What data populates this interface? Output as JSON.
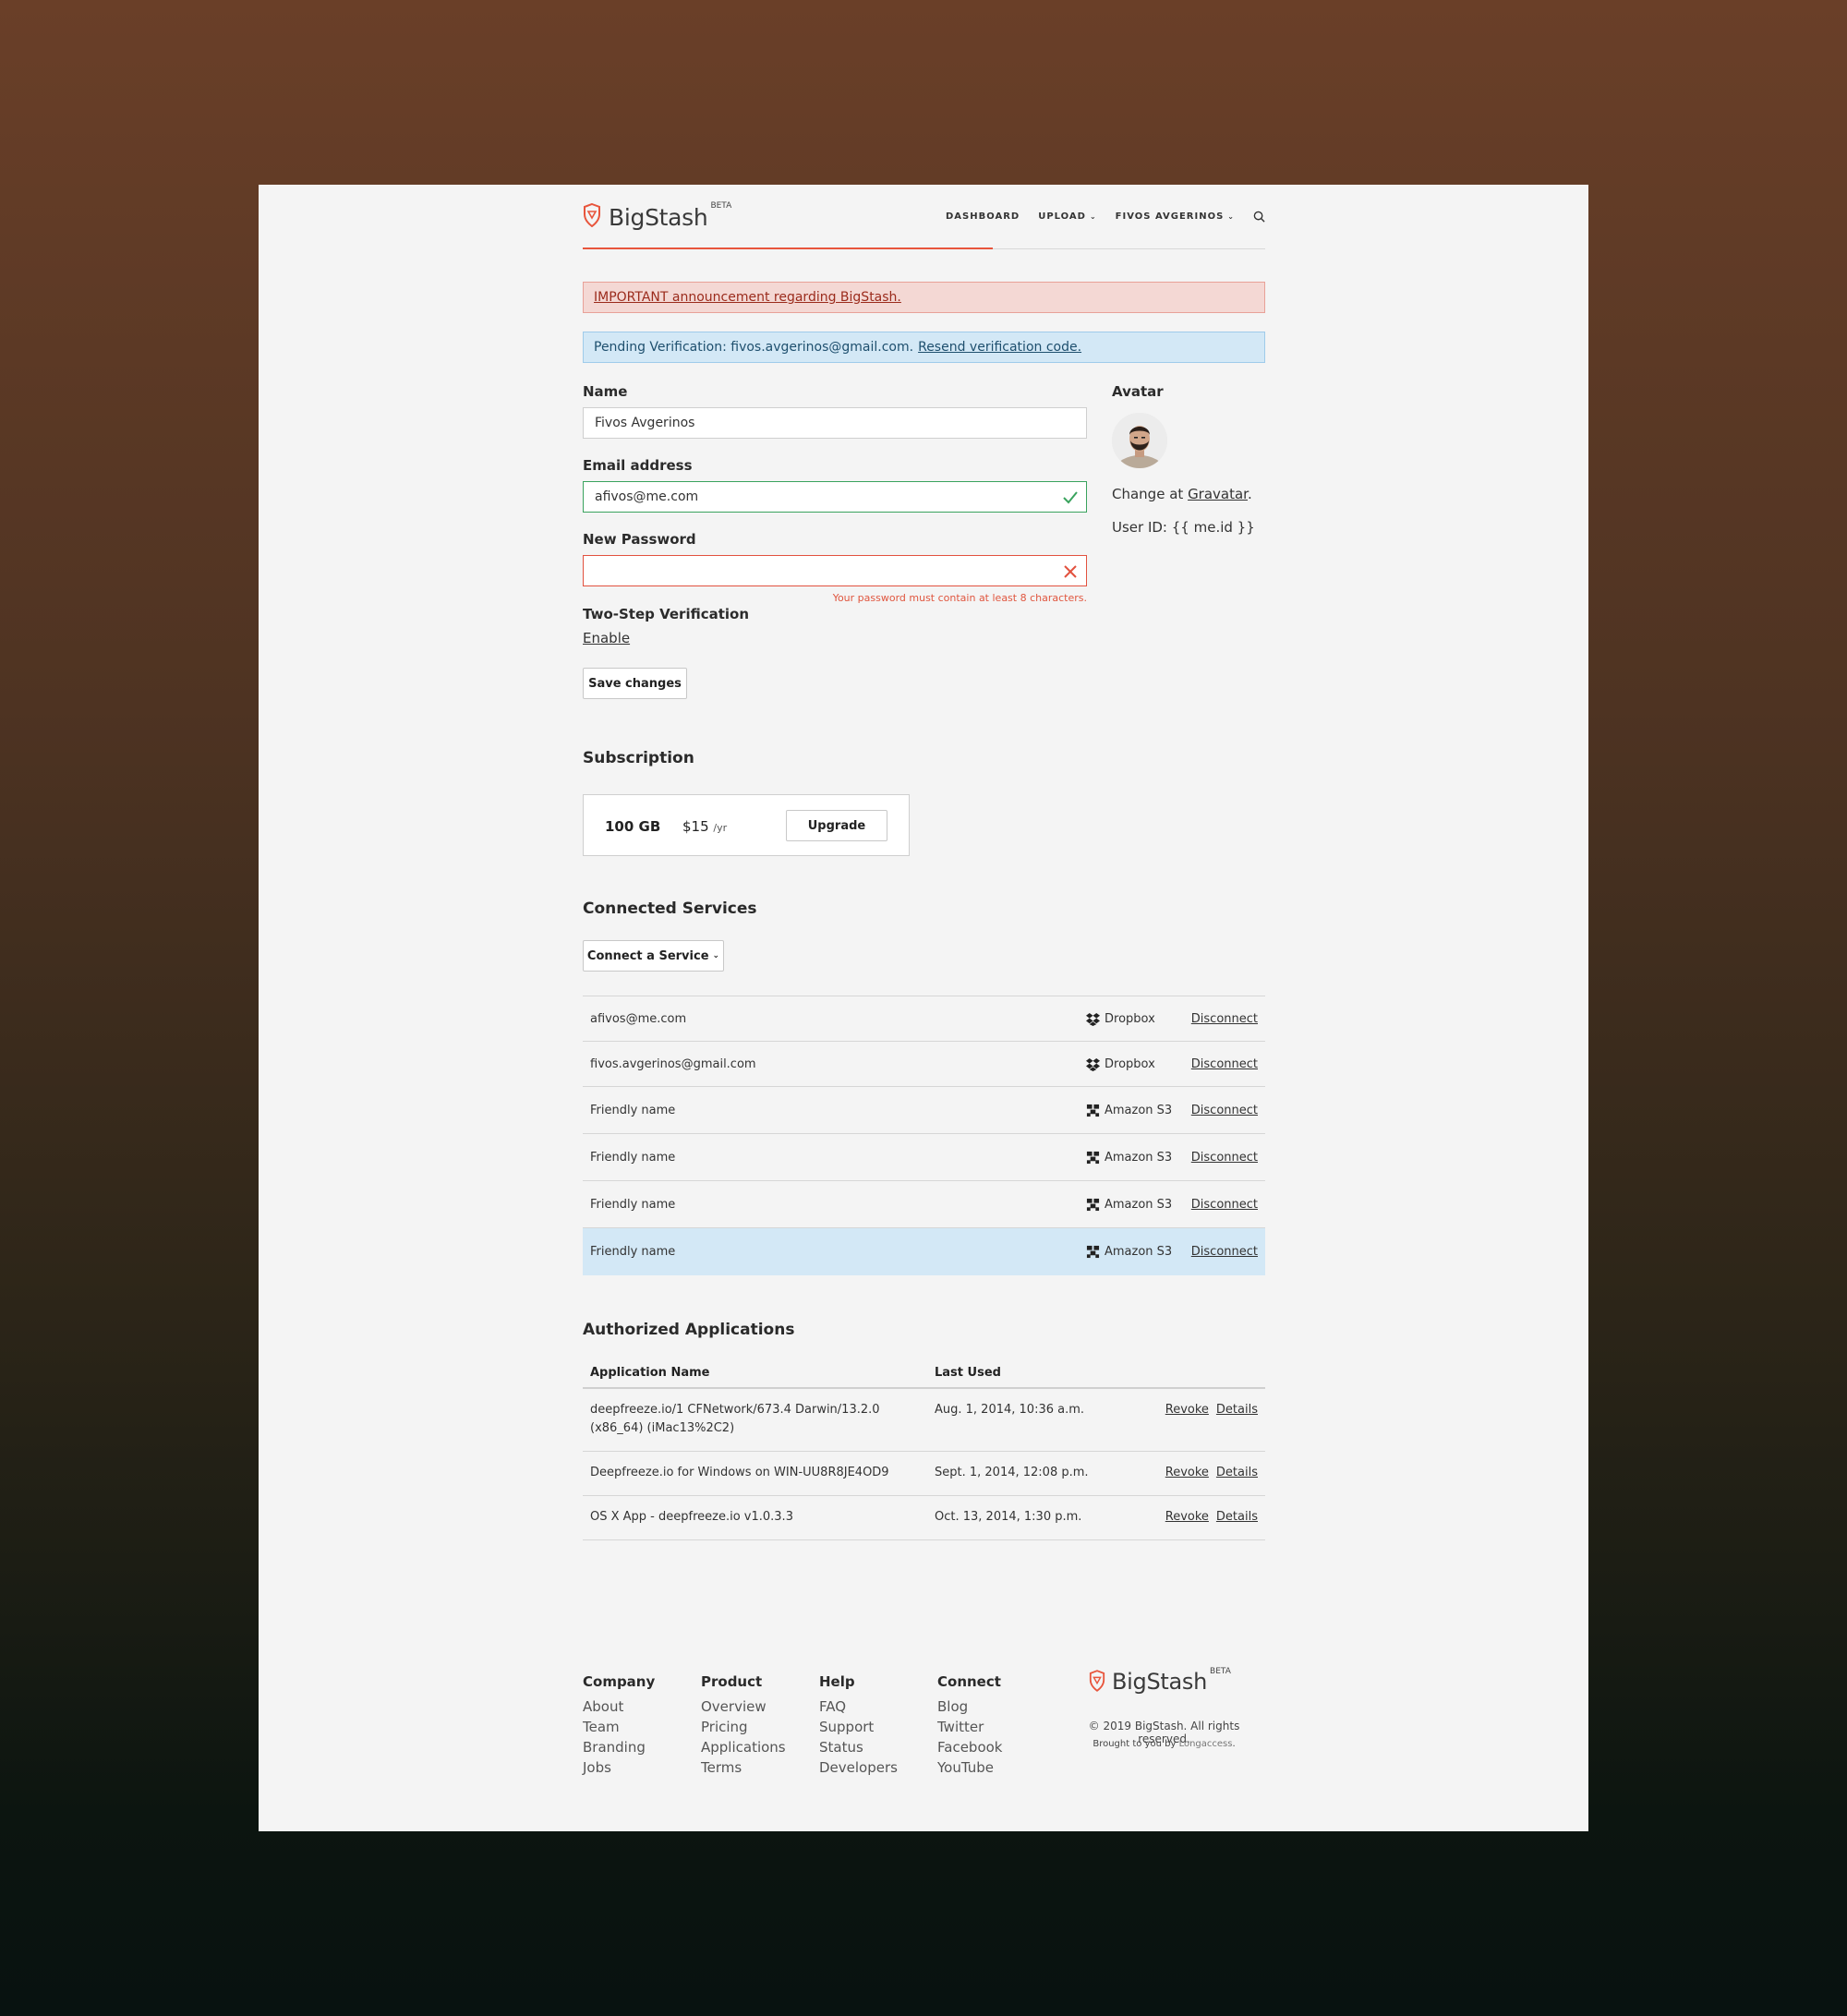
{
  "header": {
    "brand": "BigStash",
    "beta": "BETA",
    "nav": {
      "dashboard": "DASHBOARD",
      "upload": "UPLOAD",
      "user": "FIVOS AVGERINOS"
    }
  },
  "alerts": {
    "announcement": "IMPORTANT announcement regarding BigStash.",
    "pending_prefix": "Pending Verification: fivos.avgerinos@gmail.com.",
    "pending_link": "Resend verification code."
  },
  "form": {
    "name_label": "Name",
    "name_value": "Fivos Avgerinos",
    "email_label": "Email address",
    "email_value": "afivos@me.com",
    "password_label": "New Password",
    "password_value": "",
    "password_error": "Your password must contain at least 8 characters.",
    "twostep_label": "Two-Step Verification",
    "twostep_link": "Enable",
    "save_label": "Save changes"
  },
  "avatar": {
    "label": "Avatar",
    "change_prefix": "Change at",
    "change_link": "Gravatar",
    "change_suffix": ".",
    "user_id": "User ID: {{ me.id }}"
  },
  "subscription": {
    "title": "Subscription",
    "size": "100 GB",
    "price": "$15",
    "period": "/yr",
    "upgrade_label": "Upgrade"
  },
  "services": {
    "title": "Connected Services",
    "connect_label": "Connect a Service",
    "rows": [
      {
        "account": "afivos@me.com",
        "provider": "Dropbox",
        "action": "Disconnect"
      },
      {
        "account": "fivos.avgerinos@gmail.com",
        "provider": "Dropbox",
        "action": "Disconnect"
      },
      {
        "account": "Friendly name",
        "provider": "Amazon S3",
        "action": "Disconnect"
      },
      {
        "account": "Friendly name",
        "provider": "Amazon S3",
        "action": "Disconnect"
      },
      {
        "account": "Friendly name",
        "provider": "Amazon S3",
        "action": "Disconnect"
      },
      {
        "account": "Friendly name",
        "provider": "Amazon S3",
        "action": "Disconnect"
      }
    ]
  },
  "applications": {
    "title": "Authorized Applications",
    "col_name": "Application Name",
    "col_last": "Last Used",
    "rows": [
      {
        "name": "deepfreeze.io/1 CFNetwork/673.4 Darwin/13.2.0 (x86_64) (iMac13%2C2)",
        "last": "Aug. 1, 2014, 10:36 a.m.",
        "revoke": "Revoke",
        "details": "Details"
      },
      {
        "name": "Deepfreeze.io for Windows on WIN-UU8R8JE4OD9",
        "last": "Sept. 1, 2014, 12:08 p.m.",
        "revoke": "Revoke",
        "details": "Details"
      },
      {
        "name": "OS X App - deepfreeze.io v1.0.3.3",
        "last": "Oct. 13, 2014, 1:30 p.m.",
        "revoke": "Revoke",
        "details": "Details"
      }
    ]
  },
  "footer": {
    "company": {
      "title": "Company",
      "links": [
        "About",
        "Team",
        "Branding",
        "Jobs"
      ]
    },
    "product": {
      "title": "Product",
      "links": [
        "Overview",
        "Pricing",
        "Applications",
        "Terms"
      ]
    },
    "help": {
      "title": "Help",
      "links": [
        "FAQ",
        "Support",
        "Status",
        "Developers"
      ]
    },
    "connect": {
      "title": "Connect",
      "links": [
        "Blog",
        "Twitter",
        "Facebook",
        "YouTube"
      ]
    },
    "brand": "BigStash",
    "beta": "BETA",
    "copyright": "© 2019 BigStash. All rights reserved.",
    "brought_prefix": "Brought to you by",
    "brought_link": "Longaccess",
    "brought_suffix": "."
  },
  "colors": {
    "accent": "#e8553c",
    "success": "#3aa35e",
    "info_bg": "#d3e8f6",
    "danger_bg": "#f4d8d4"
  },
  "icons": [
    "shield-logo-icon",
    "search-icon",
    "chevron-down-icon",
    "check-icon",
    "x-icon",
    "dropbox-icon",
    "amazon-s3-icon"
  ]
}
